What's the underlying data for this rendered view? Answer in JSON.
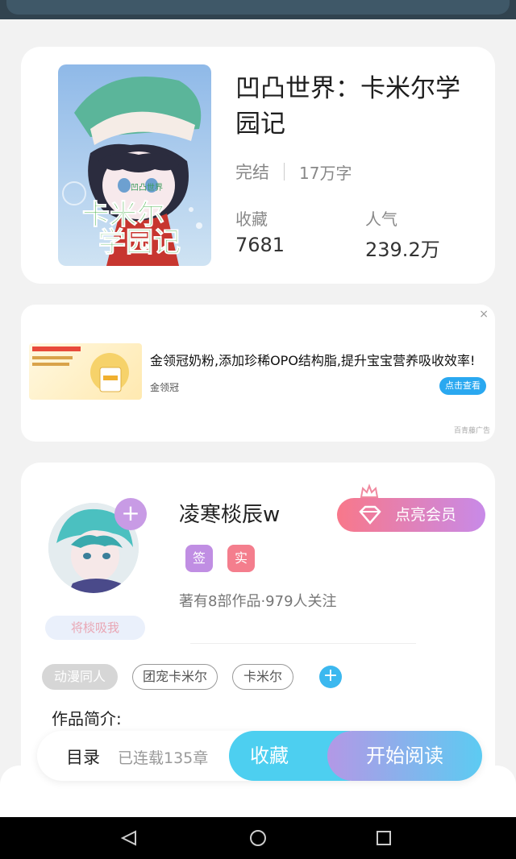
{
  "book": {
    "title": "凹凸世界：卡米尔学园记",
    "status": "完结",
    "word_count": "17万字",
    "favorites_label": "收藏",
    "favorites_value": "7681",
    "popularity_label": "人气",
    "popularity_value": "239.2万",
    "cover_title_text": "卡米尔学园记",
    "cover_subtitle_text": "凹凸世界"
  },
  "ad": {
    "close_symbol": "×",
    "text": "金领冠奶粉,添加珍稀OPO结构脂,提升宝宝营养吸收效率!",
    "brand": "金领冠",
    "button_label": "点击查看",
    "tag": "百青藤广告"
  },
  "author": {
    "name": "凌寒棪辰w",
    "vip_label": "点亮会员",
    "badge_signed": "签",
    "badge_verified": "实",
    "works_text": "著有8部作品·979人关注",
    "hug_label": "将棪吸我",
    "follow_symbol": "+"
  },
  "tags": [
    "动漫同人",
    "团宠卡米尔",
    "卡米尔"
  ],
  "tag_add_symbol": "+",
  "intro_label": "作品简介:",
  "bottom_bar": {
    "toc_label": "目录",
    "serial_text": "已连载135章",
    "fav_label": "收藏",
    "read_label": "开始阅读"
  },
  "colors": {
    "accent_blue": "#4dcff0",
    "accent_purple": "#c89be5",
    "badge_signed": "#c08ee3",
    "badge_verified": "#f47e8d"
  },
  "icons": [
    "back-triangle-icon",
    "home-circle-icon",
    "recent-square-icon",
    "crown-icon",
    "diamond-icon",
    "plus-icon"
  ]
}
